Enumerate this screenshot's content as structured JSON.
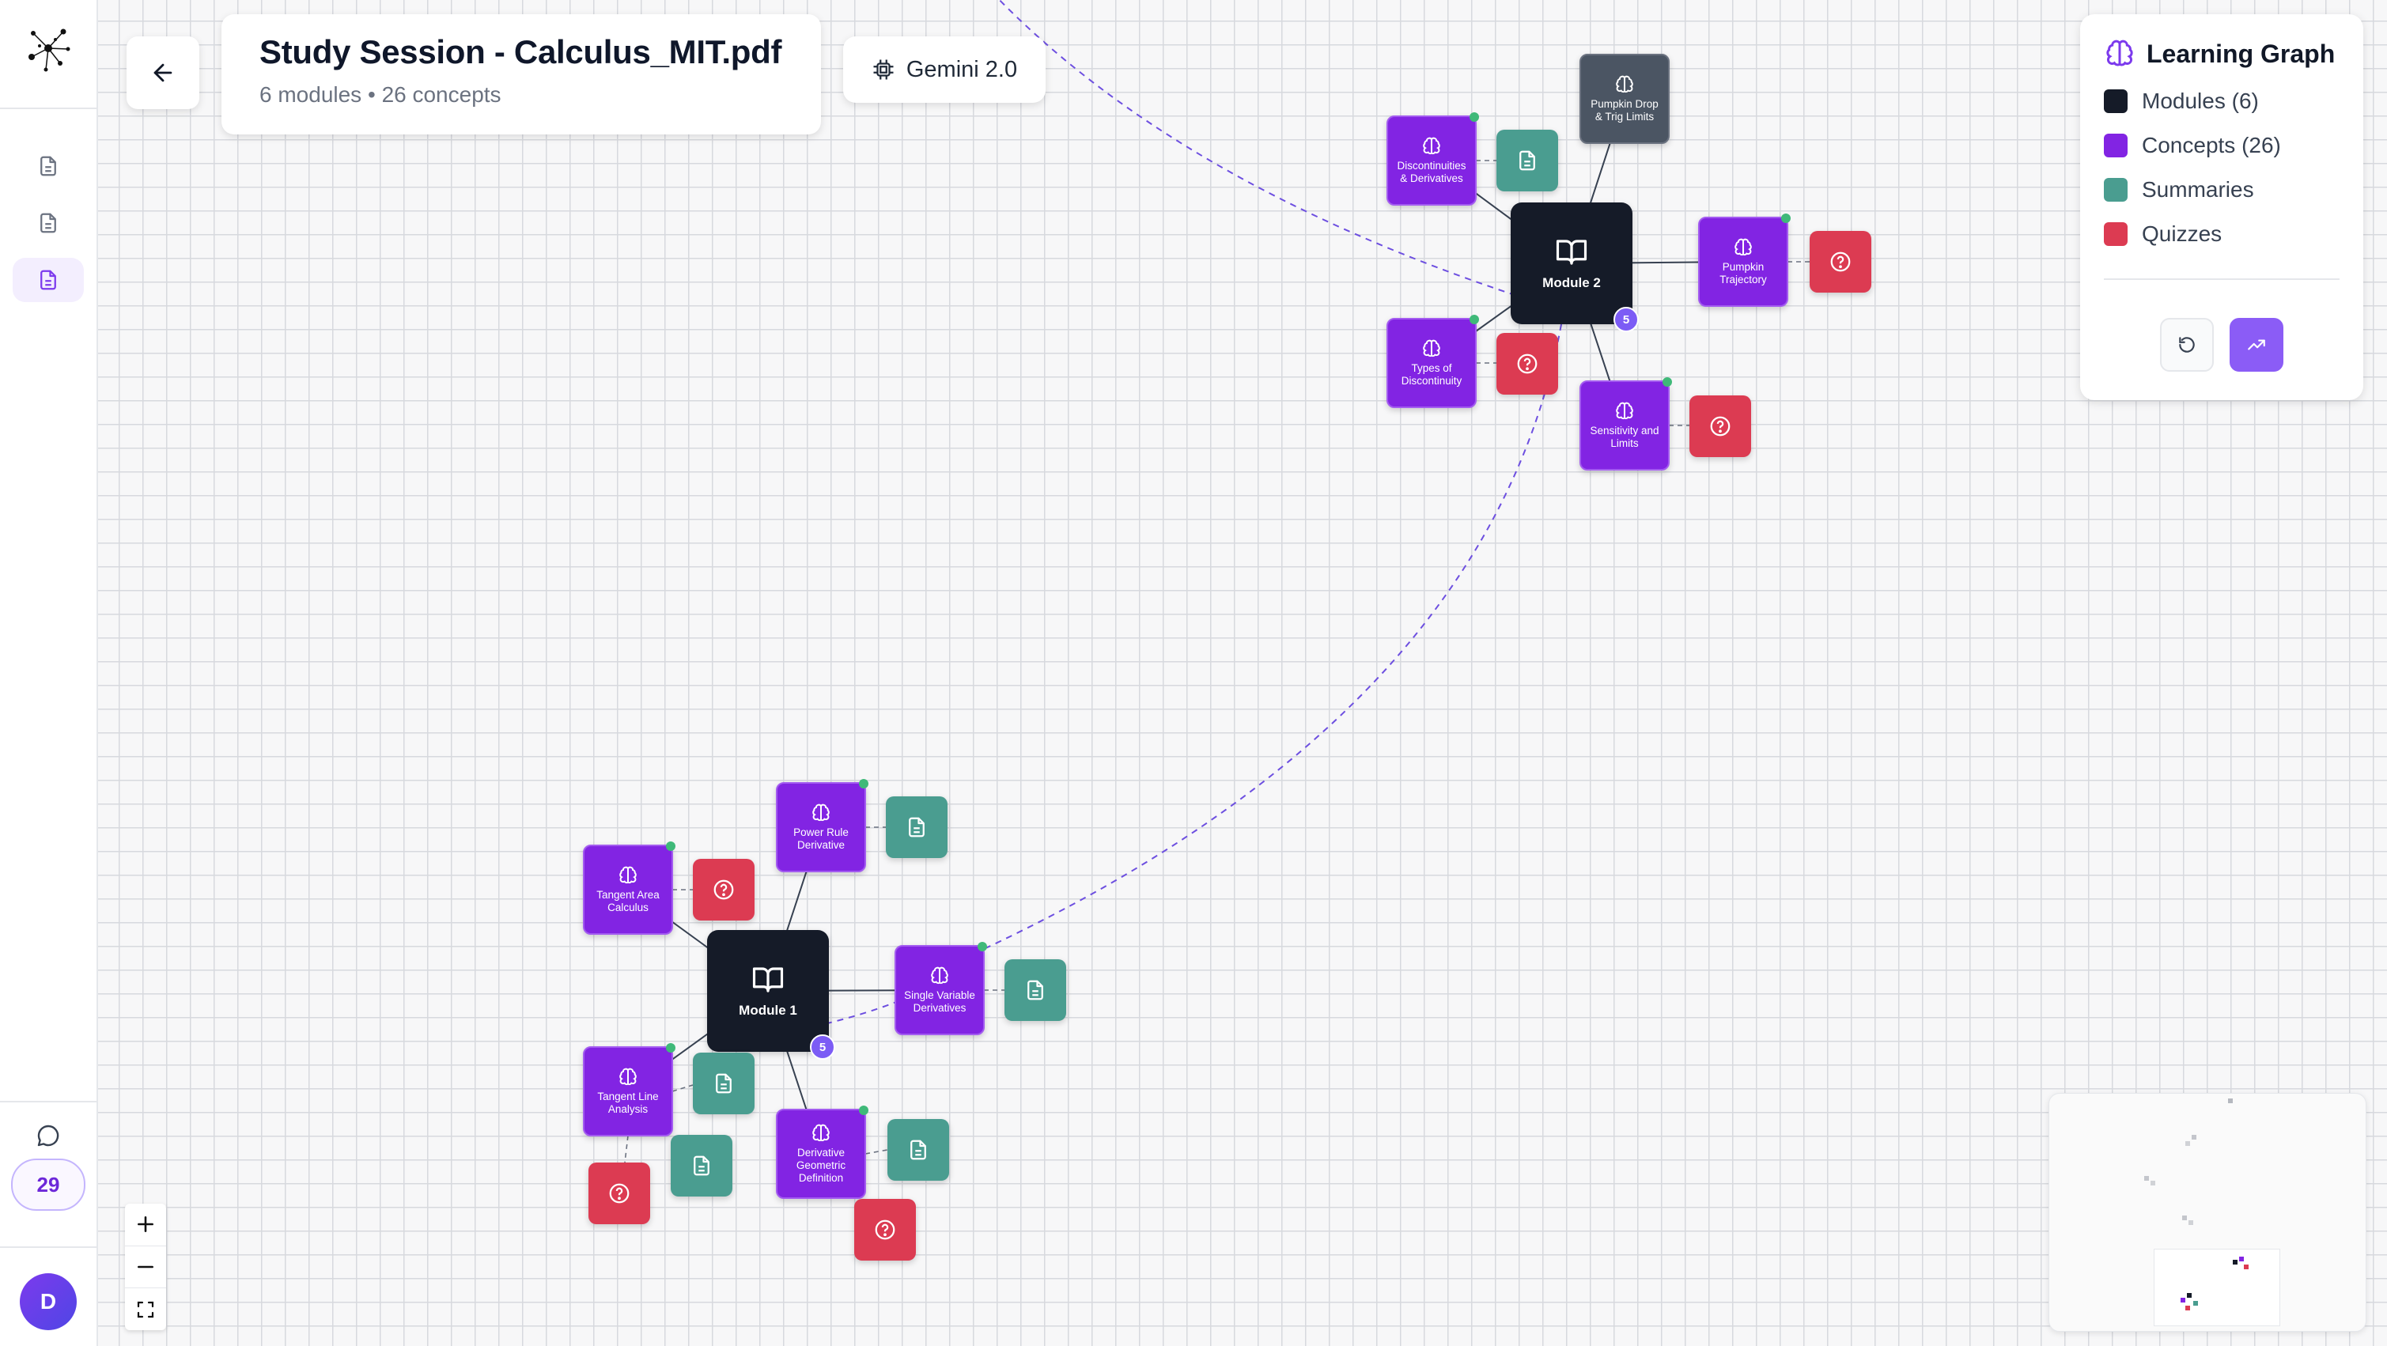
{
  "sidebar": {
    "nav_items": [
      {
        "name": "document-1",
        "active": false
      },
      {
        "name": "document-2",
        "active": false
      },
      {
        "name": "document-3",
        "active": true
      }
    ],
    "credits": "29",
    "avatar_initial": "D"
  },
  "header": {
    "title": "Study Session - Calculus_MIT.pdf",
    "modules_count": "6 modules",
    "separator": "•",
    "concepts_count": "26 concepts",
    "model": "Gemini 2.0"
  },
  "legend": {
    "title": "Learning Graph",
    "items": [
      {
        "label": "Modules (6)",
        "color": "#151b28"
      },
      {
        "label": "Concepts (26)",
        "color": "#8224e3"
      },
      {
        "label": "Summaries",
        "color": "#4a9d90"
      },
      {
        "label": "Quizzes",
        "color": "#dc3b52"
      }
    ]
  },
  "graph": {
    "modules": [
      {
        "id": "m1",
        "label": "Module 1",
        "badge": "5"
      },
      {
        "id": "m2",
        "label": "Module 2",
        "badge": "5"
      }
    ],
    "concepts": [
      {
        "id": "c1",
        "label": "Discontinuities & Derivatives"
      },
      {
        "id": "c2",
        "label": "Pumpkin Drop & Trig Limits"
      },
      {
        "id": "c3",
        "label": "Pumpkin Trajectory"
      },
      {
        "id": "c4",
        "label": "Types of Discontinuity"
      },
      {
        "id": "c5",
        "label": "Sensitivity and Limits"
      },
      {
        "id": "c6",
        "label": "Power Rule Derivative"
      },
      {
        "id": "c7",
        "label": "Tangent Area Calculus"
      },
      {
        "id": "c8",
        "label": "Single Variable Derivatives"
      },
      {
        "id": "c9",
        "label": "Tangent Line Analysis"
      },
      {
        "id": "c10",
        "label": "Derivative Geometric Definition"
      }
    ],
    "colors": {
      "module": "#151b28",
      "concept": "#8224e3",
      "concept_muted": "#4b5563",
      "summary": "#4a9d90",
      "quiz": "#dc3b52",
      "link": "#6d4fe0"
    }
  }
}
